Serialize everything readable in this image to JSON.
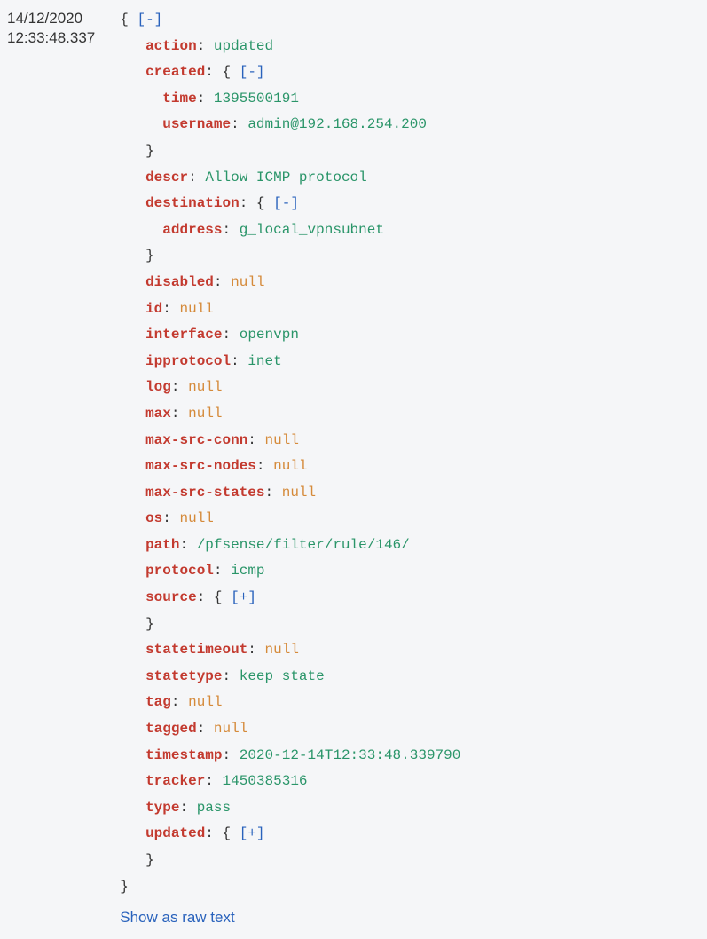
{
  "timestamp": {
    "date": "14/12/2020",
    "time": "12:33:48.337"
  },
  "toggles": {
    "collapse": "[-]",
    "expand": "[+]"
  },
  "keys": {
    "action": "action",
    "created": "created",
    "time": "time",
    "username": "username",
    "descr": "descr",
    "destination": "destination",
    "address": "address",
    "disabled": "disabled",
    "id": "id",
    "interface": "interface",
    "ipprotocol": "ipprotocol",
    "log": "log",
    "max": "max",
    "max_src_conn": "max-src-conn",
    "max_src_nodes": "max-src-nodes",
    "max_src_states": "max-src-states",
    "os": "os",
    "path": "path",
    "protocol": "protocol",
    "source": "source",
    "statetimeout": "statetimeout",
    "statetype": "statetype",
    "tag": "tag",
    "tagged": "tagged",
    "timestamp": "timestamp",
    "tracker": "tracker",
    "type": "type",
    "updated": "updated"
  },
  "values": {
    "action": "updated",
    "created_time": "1395500191",
    "created_username": "admin@192.168.254.200",
    "descr": "Allow ICMP protocol",
    "destination_address": "g_local_vpnsubnet",
    "disabled": "null",
    "id": "null",
    "interface": "openvpn",
    "ipprotocol": "inet",
    "log": "null",
    "max": "null",
    "max_src_conn": "null",
    "max_src_nodes": "null",
    "max_src_states": "null",
    "os": "null",
    "path": "/pfsense/filter/rule/146/",
    "protocol": "icmp",
    "statetimeout": "null",
    "statetype": "keep state",
    "tag": "null",
    "tagged": "null",
    "timestamp": "2020-12-14T12:33:48.339790",
    "tracker": "1450385316",
    "type": "pass"
  },
  "footer": {
    "raw_text_link": "Show as raw text"
  }
}
